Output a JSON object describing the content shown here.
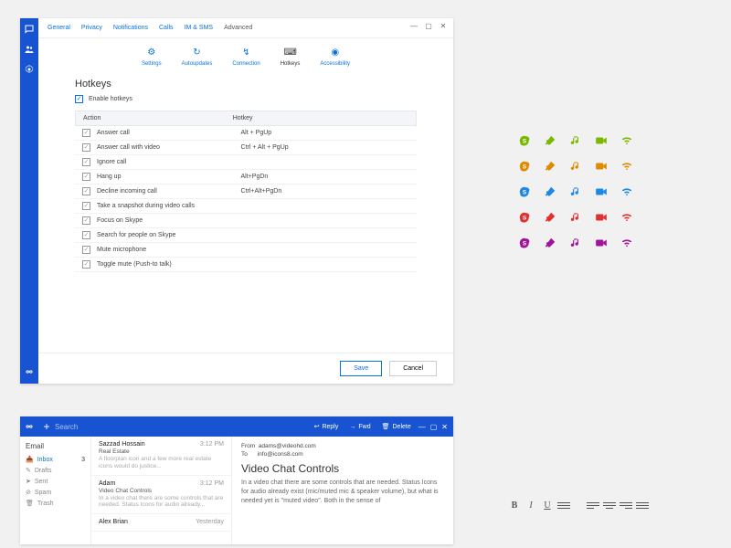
{
  "settings": {
    "tabs": [
      "General",
      "Privacy",
      "Notifications",
      "Calls",
      "IM & SMS",
      "Advanced"
    ],
    "active_tab_index": 5,
    "window_controls": {
      "min": "—",
      "max": "▢",
      "close": "✕"
    },
    "subtabs": [
      {
        "label": "Settings",
        "icon": "gear"
      },
      {
        "label": "Autoupdates",
        "icon": "refresh"
      },
      {
        "label": "Connection",
        "icon": "link"
      },
      {
        "label": "Hotkeys",
        "icon": "keyboard"
      },
      {
        "label": "Accessibility",
        "icon": "access"
      }
    ],
    "active_subtab_index": 3,
    "heading": "Hotkeys",
    "enable_label": "Enable hotkeys",
    "enable_checked": true,
    "columns": {
      "action": "Action",
      "hotkey": "Hotkey"
    },
    "rows": [
      {
        "checked": true,
        "action": "Answer call",
        "hotkey": "Alt + PgUp"
      },
      {
        "checked": true,
        "action": "Answer call with video",
        "hotkey": "Ctrl + Alt + PgUp"
      },
      {
        "checked": true,
        "action": "Ignore call",
        "hotkey": ""
      },
      {
        "checked": true,
        "action": "Hang up",
        "hotkey": "Alt+PgDn"
      },
      {
        "checked": true,
        "action": "Decline incoming call",
        "hotkey": "Ctrl+Alt+PgDn"
      },
      {
        "checked": true,
        "action": "Take a snapshot during video calls",
        "hotkey": ""
      },
      {
        "checked": true,
        "action": "Focus on Skype",
        "hotkey": ""
      },
      {
        "checked": true,
        "action": "Search for people on Skype",
        "hotkey": ""
      },
      {
        "checked": true,
        "action": "Mute microphone",
        "hotkey": ""
      },
      {
        "checked": true,
        "action": "Toggle mute (Push-to talk)",
        "hotkey": ""
      }
    ],
    "buttons": {
      "save": "Save",
      "cancel": "Cancel"
    }
  },
  "icon_grid": {
    "colors": [
      "#7ab800",
      "#e08a00",
      "#1e88e5",
      "#e03030",
      "#a0149a"
    ],
    "icons": [
      "skype",
      "brush",
      "music",
      "video",
      "wifi"
    ]
  },
  "mail": {
    "search_placeholder": "Search",
    "actions": {
      "reply": "Reply",
      "fwd": "Fwd",
      "delete": "Delete"
    },
    "window_controls": {
      "min": "—",
      "max": "▢",
      "close": "✕"
    },
    "folders_heading": "Email",
    "folders": [
      {
        "name": "Inbox",
        "selected": true,
        "count": "3"
      },
      {
        "name": "Drafts"
      },
      {
        "name": "Sent"
      },
      {
        "name": "Spam"
      },
      {
        "name": "Trash"
      }
    ],
    "messages": [
      {
        "name": "Sazzad Hossain",
        "time": "3:12 PM",
        "subj": "Real Estate",
        "preview": "A floorplan icon and a few more real estate icons would do justice..."
      },
      {
        "name": "Adam",
        "time": "3:12 PM",
        "subj": "Video Chat Controls",
        "preview": "In a video chat there are some controls that are needed. Status Icons for audio already..."
      },
      {
        "name": "Alex Brian",
        "time": "Yesterday",
        "subj": "",
        "preview": ""
      }
    ],
    "reader": {
      "from_label": "From",
      "from": "adams@videohd.com",
      "to_label": "To",
      "to": "info@icons8.com",
      "subject": "Video Chat Controls",
      "body": "In a video chat there are some controls that are needed. Status Icons for audio already exist (mic/muted mic & speaker volume), but what is needed yet is \"muted video\". Both in the sense of"
    }
  },
  "format_icons": {
    "bold": "B",
    "italic": "I",
    "underline": "U"
  }
}
